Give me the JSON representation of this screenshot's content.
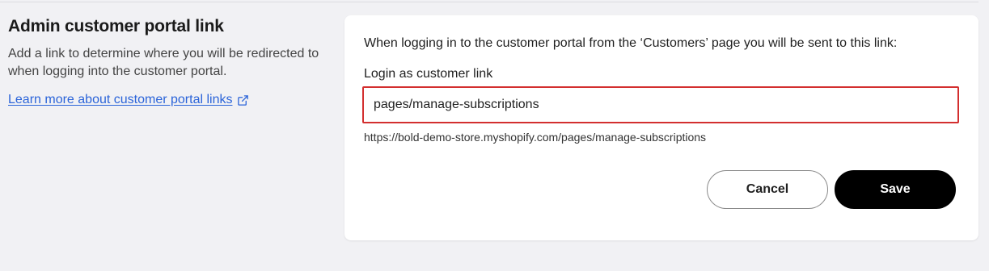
{
  "section": {
    "title": "Admin customer portal link",
    "description": "Add a link to determine where you will be redirected to when logging into the customer portal.",
    "learn_more_link": "Learn more about customer portal links",
    "learn_more_icon": "external-link-icon"
  },
  "card": {
    "description": "When logging in to the customer portal from the ‘Customers’ page you will be sent to this link:",
    "field_label": "Login as customer link",
    "field_value": "pages/manage-subscriptions",
    "helper_url": "https://bold-demo-store.myshopify.com/pages/manage-subscriptions",
    "cancel_label": "Cancel",
    "save_label": "Save"
  },
  "colors": {
    "page_bg": "#f1f1f4",
    "link": "#2b64d9",
    "error_border": "#d32f2f",
    "primary_button": "#000000"
  }
}
